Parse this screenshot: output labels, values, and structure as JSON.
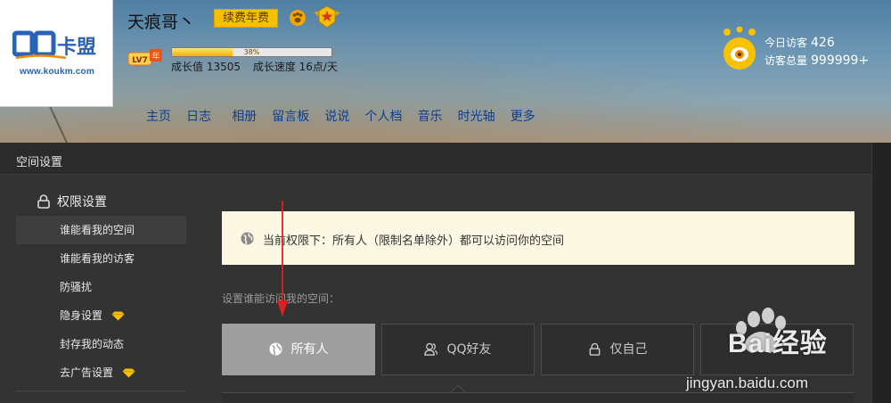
{
  "header": {
    "logo_url": "www.koukm.com",
    "user_name": "天痕哥丶",
    "renew_label": "续费年费",
    "level_badge": "LV7",
    "level_year": "年",
    "progress_percent": 38,
    "progress_label": "38%",
    "growth_value_text": "成长值 13505",
    "growth_speed_text": "成长速度 16点/天",
    "nav": [
      "主页",
      "日志",
      "相册",
      "留言板",
      "说说",
      "个人档",
      "音乐",
      "时光轴",
      "更多"
    ],
    "visitors": {
      "today_label": "今日访客",
      "today_value": "426",
      "total_label": "访客总量",
      "total_value": "999999+"
    }
  },
  "panel": {
    "title": "空间设置",
    "sidebar": {
      "section_label": "权限设置",
      "items": [
        {
          "label": "谁能看我的空间",
          "active": true
        },
        {
          "label": "谁能看我的访客",
          "active": false
        },
        {
          "label": "防骚扰",
          "active": false
        },
        {
          "label": "隐身设置",
          "active": false,
          "gem": true
        },
        {
          "label": "封存我的动态",
          "active": false
        },
        {
          "label": "去广告设置",
          "active": false,
          "gem": true
        }
      ]
    },
    "notice_text": "当前权限下：所有人（限制名单除外）都可以访问你的空间",
    "subhead": "设置谁能访问我的空间：",
    "options": [
      {
        "label": "所有人",
        "icon": "globe-icon",
        "selected": true
      },
      {
        "label": "QQ好友",
        "icon": "friends-icon",
        "selected": false
      },
      {
        "label": "仅自己",
        "icon": "lock-icon",
        "selected": false
      }
    ]
  },
  "watermark": {
    "brand": "Bai",
    "suffix": "经验",
    "url": "jingyan.baidu.com"
  },
  "colors": {
    "accent_gold": "#f5c000",
    "nav_blue": "#0d3f8f",
    "annotation_red": "#e02020"
  }
}
